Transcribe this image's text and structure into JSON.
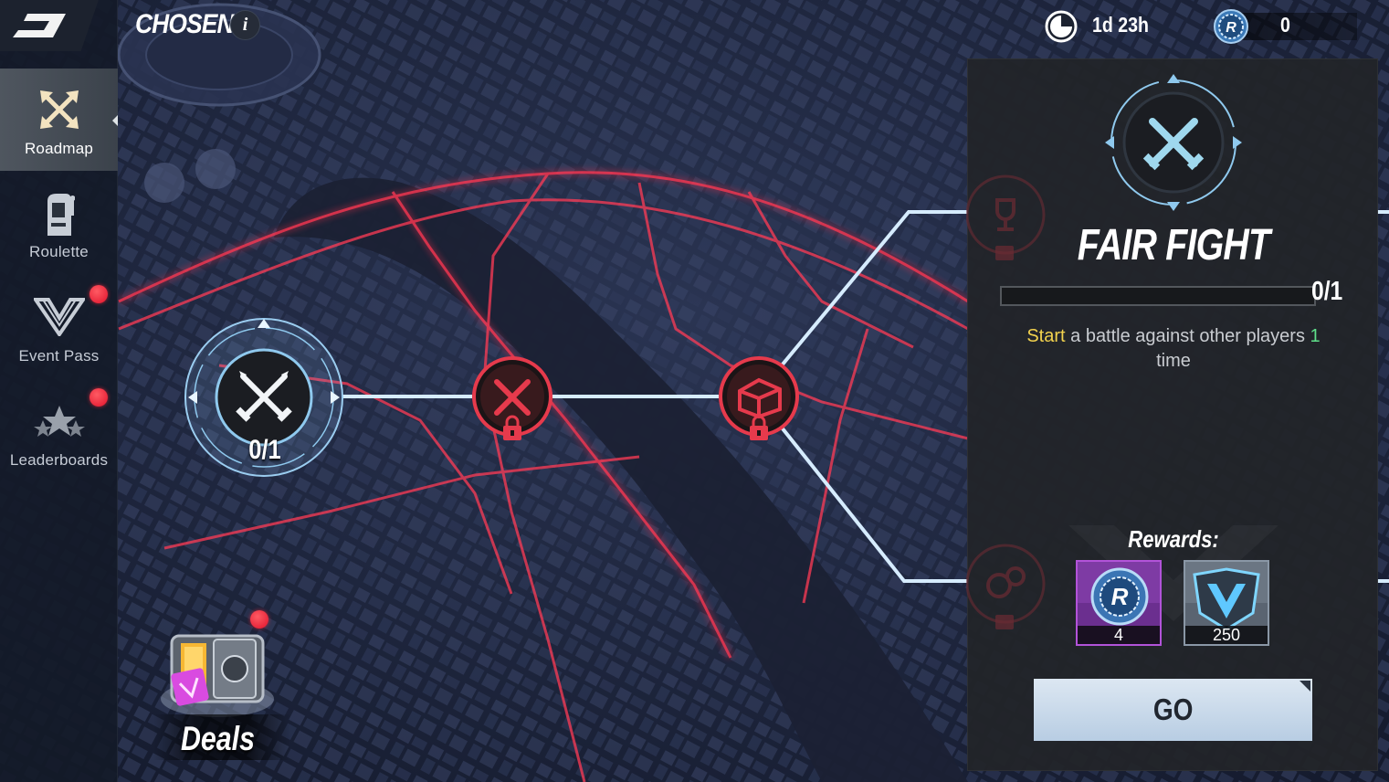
{
  "header": {
    "event_title": "CHOSEN",
    "info_icon": "info-icon",
    "info_symbol": "i",
    "timer_icon": "clock-icon",
    "timer": "1d 23h",
    "currency_icon": "coin-icon",
    "currency_value": "0"
  },
  "sidebar": {
    "items": [
      {
        "label": "Roadmap",
        "icon": "crossed-arrows-icon",
        "active": true,
        "badge": false
      },
      {
        "label": "Roulette",
        "icon": "slot-machine-icon",
        "active": false,
        "badge": false
      },
      {
        "label": "Event Pass",
        "icon": "v-emblem-icon",
        "active": false,
        "badge": true
      },
      {
        "label": "Leaderboards",
        "icon": "stars-icon",
        "active": false,
        "badge": true
      }
    ]
  },
  "map": {
    "nodes": [
      {
        "id": "fair-fight",
        "state": "active",
        "icon": "crossed-swords-icon",
        "progress": "0/1"
      },
      {
        "id": "battle-locked",
        "state": "locked",
        "icon": "crossed-swords-icon"
      },
      {
        "id": "chest-locked",
        "state": "locked",
        "icon": "chest-icon"
      },
      {
        "id": "branch-top",
        "state": "locked",
        "icon": "trophy-icon"
      },
      {
        "id": "branch-bottom",
        "state": "locked",
        "icon": "bubbles-icon"
      }
    ]
  },
  "deals": {
    "label": "Deals",
    "badge": true
  },
  "panel": {
    "title": "FAIR FIGHT",
    "progress_text": "0/1",
    "progress_fraction": 0,
    "desc_verb": "Start",
    "desc_middle": " a battle against other players ",
    "desc_count": "1",
    "desc_end": " time",
    "rewards_title": "Rewards:",
    "rewards": [
      {
        "icon": "coin-icon",
        "amount": "4",
        "rarity_color": "#b253d9"
      },
      {
        "icon": "v-token-icon",
        "amount": "250",
        "rarity_color": "#8a97a6"
      }
    ],
    "go_label": "GO"
  },
  "colors": {
    "accent_red": "#e63a4c",
    "path_blue": "#c9e7ff",
    "node_blue": "#8fc9ee"
  }
}
